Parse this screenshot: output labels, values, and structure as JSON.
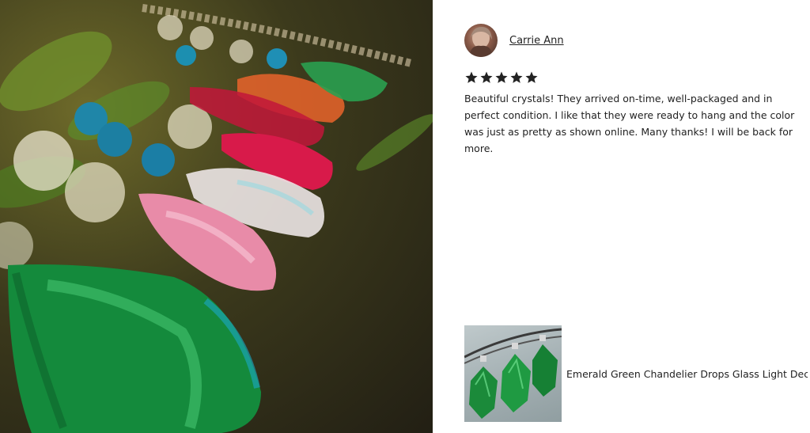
{
  "review": {
    "reviewer_name": "Carrie Ann",
    "rating": 5,
    "rating_max": 5,
    "text": "Beautiful crystals! They arrived on-time, well-packaged and in perfect condition. I like that they were ready to hang and the color was just as pretty as shown online. Many thanks! I will be back for more."
  },
  "product": {
    "title": "Emerald Green Chandelier Drops Glass Light Deco ..."
  },
  "colors": {
    "star": "#222222",
    "text": "#222222",
    "emerald": "#1f8a3a"
  },
  "icons": {
    "star": "star-icon"
  }
}
